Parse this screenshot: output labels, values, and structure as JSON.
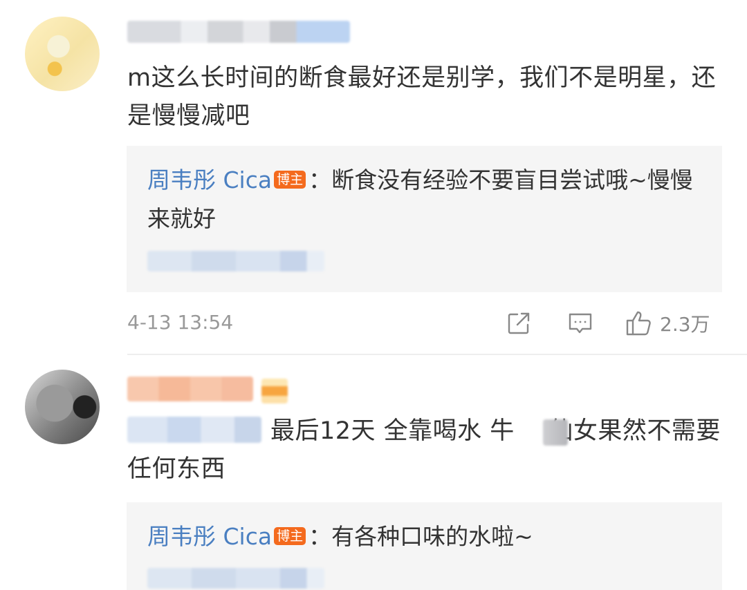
{
  "comments": [
    {
      "text": "m这么长时间的断食最好还是别学，我们不是明星，还是慢慢减吧",
      "reply": {
        "author": "周韦彤 Cica",
        "badge": "博主",
        "text": "：断食没有经验不要盲目尝试哦~慢慢来就好"
      },
      "timestamp": "4-13 13:54",
      "actions": {
        "like_count": "2.3万"
      }
    },
    {
      "text_before": "最后12天 全靠喝水 牛",
      "text_after": " 仙女果然不需要任何东西",
      "reply": {
        "author": "周韦彤 Cica",
        "badge": "博主",
        "text": "：有各种口味的水啦~"
      }
    }
  ],
  "icons": {
    "share": "share-icon",
    "comment": "comment-icon",
    "like": "thumbs-up-icon"
  },
  "colors": {
    "author_link": "#4a7fc1",
    "badge": "#f46a1d",
    "reply_background": "#f5f5f5",
    "meta_text": "#999999"
  }
}
